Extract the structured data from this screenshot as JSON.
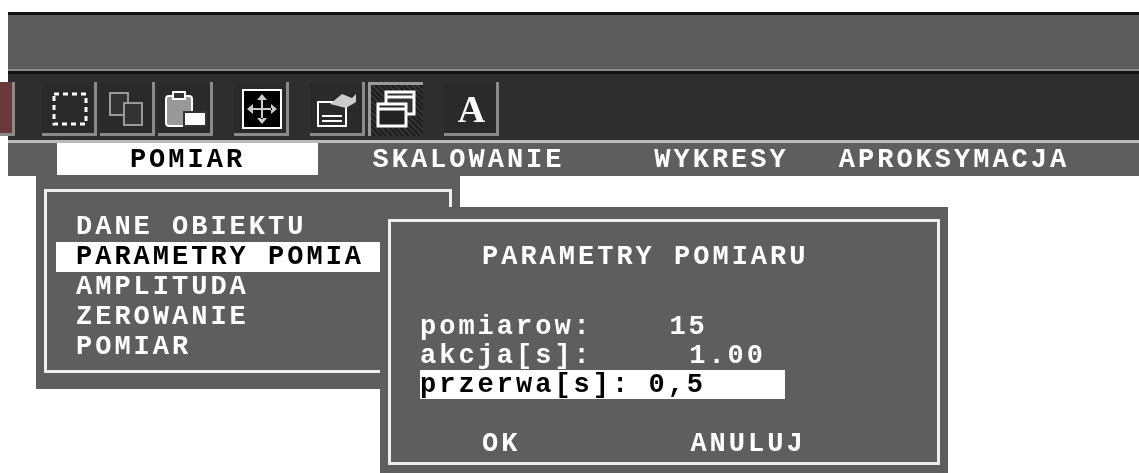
{
  "toolbar": [
    {
      "kind": "partial",
      "selected": false
    },
    {
      "kind": "select",
      "selected": false
    },
    {
      "kind": "copy",
      "selected": false
    },
    {
      "kind": "paste",
      "selected": false
    },
    {
      "kind": "move",
      "selected": false
    },
    {
      "kind": "properties",
      "selected": false
    },
    {
      "kind": "windows",
      "selected": true
    },
    {
      "kind": "font",
      "label": "A",
      "selected": false
    }
  ],
  "menu_bar": [
    {
      "label": "POMIAR",
      "selected": true
    },
    {
      "label": "SKALOWANIE",
      "selected": false
    },
    {
      "label": "WYKRESY",
      "selected": false
    },
    {
      "label": "APROKSYMACJA",
      "selected": false
    }
  ],
  "dropdown": [
    {
      "label": "DANE OBIEKTU",
      "selected": false
    },
    {
      "label": "PARAMETRY POMIA",
      "selected": true
    },
    {
      "label": "AMPLITUDA",
      "selected": false
    },
    {
      "label": "ZEROWANIE",
      "selected": false
    },
    {
      "label": "POMIAR",
      "selected": false
    }
  ],
  "dialog": {
    "title": "PARAMETRY POMIARU",
    "fields": [
      {
        "label": "pomiarow:",
        "value": "15",
        "selected": false
      },
      {
        "label": "akcja[s]:",
        "value": "1.00",
        "selected": false
      },
      {
        "label": "przerwa[s]:",
        "value": "0,5",
        "selected": true
      }
    ],
    "buttons": [
      "OK",
      "ANULUJ"
    ]
  }
}
